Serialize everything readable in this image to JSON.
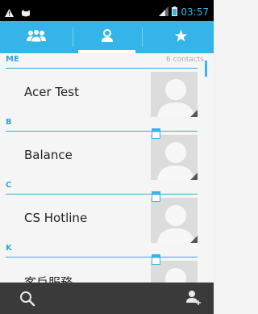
{
  "status_bar": {
    "time": "03:57",
    "icons": [
      "warning-icon",
      "cat-icon",
      "signal-icon",
      "battery-icon"
    ]
  },
  "tabs": [
    {
      "icon": "groups-icon",
      "selected": false
    },
    {
      "icon": "contacts-icon",
      "selected": true
    },
    {
      "icon": "star-icon",
      "selected": false
    }
  ],
  "sections": {
    "me": {
      "letter": "ME",
      "count": "6 contacts"
    },
    "b": {
      "letter": "B"
    },
    "c": {
      "letter": "C"
    },
    "k": {
      "letter": "K"
    }
  },
  "contacts": {
    "acer_test": "Acer Test",
    "balance": "Balance",
    "cs_hotline": "CS Hotline",
    "customer_service": "客戶服務"
  },
  "bottom_bar": {
    "icons": [
      "search-icon",
      "add-contact-icon"
    ]
  },
  "colors": {
    "accent": "#35b4ea",
    "status_bar": "#000000",
    "bottom_bar": "#3a3a3a"
  }
}
